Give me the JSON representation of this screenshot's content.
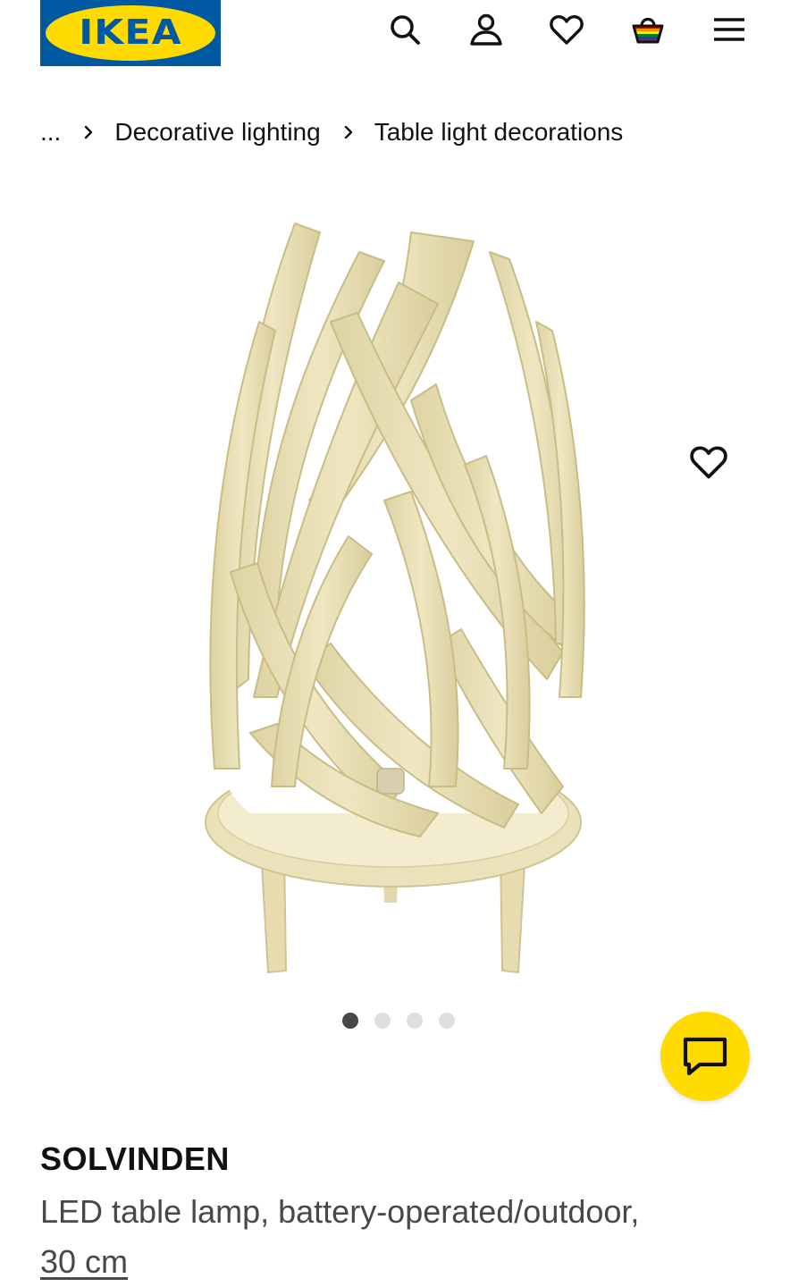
{
  "header": {
    "logo_text": "IKEA",
    "logo_reg": "®",
    "icons": [
      "search-icon",
      "account-icon",
      "wishlist-icon",
      "cart-icon",
      "menu-icon"
    ]
  },
  "breadcrumb": {
    "ellipsis": "...",
    "items": [
      "Decorative lighting",
      "Table light decorations"
    ]
  },
  "gallery": {
    "dots_total": 4,
    "active_dot": 1
  },
  "product": {
    "name": "SOLVINDEN",
    "description": "LED table lamp, battery-operated/outdoor,",
    "size": "30 cm"
  },
  "colors": {
    "brand_blue": "#0058a3",
    "brand_yellow": "#ffdb00",
    "product_beige": "#e9e0b4"
  }
}
